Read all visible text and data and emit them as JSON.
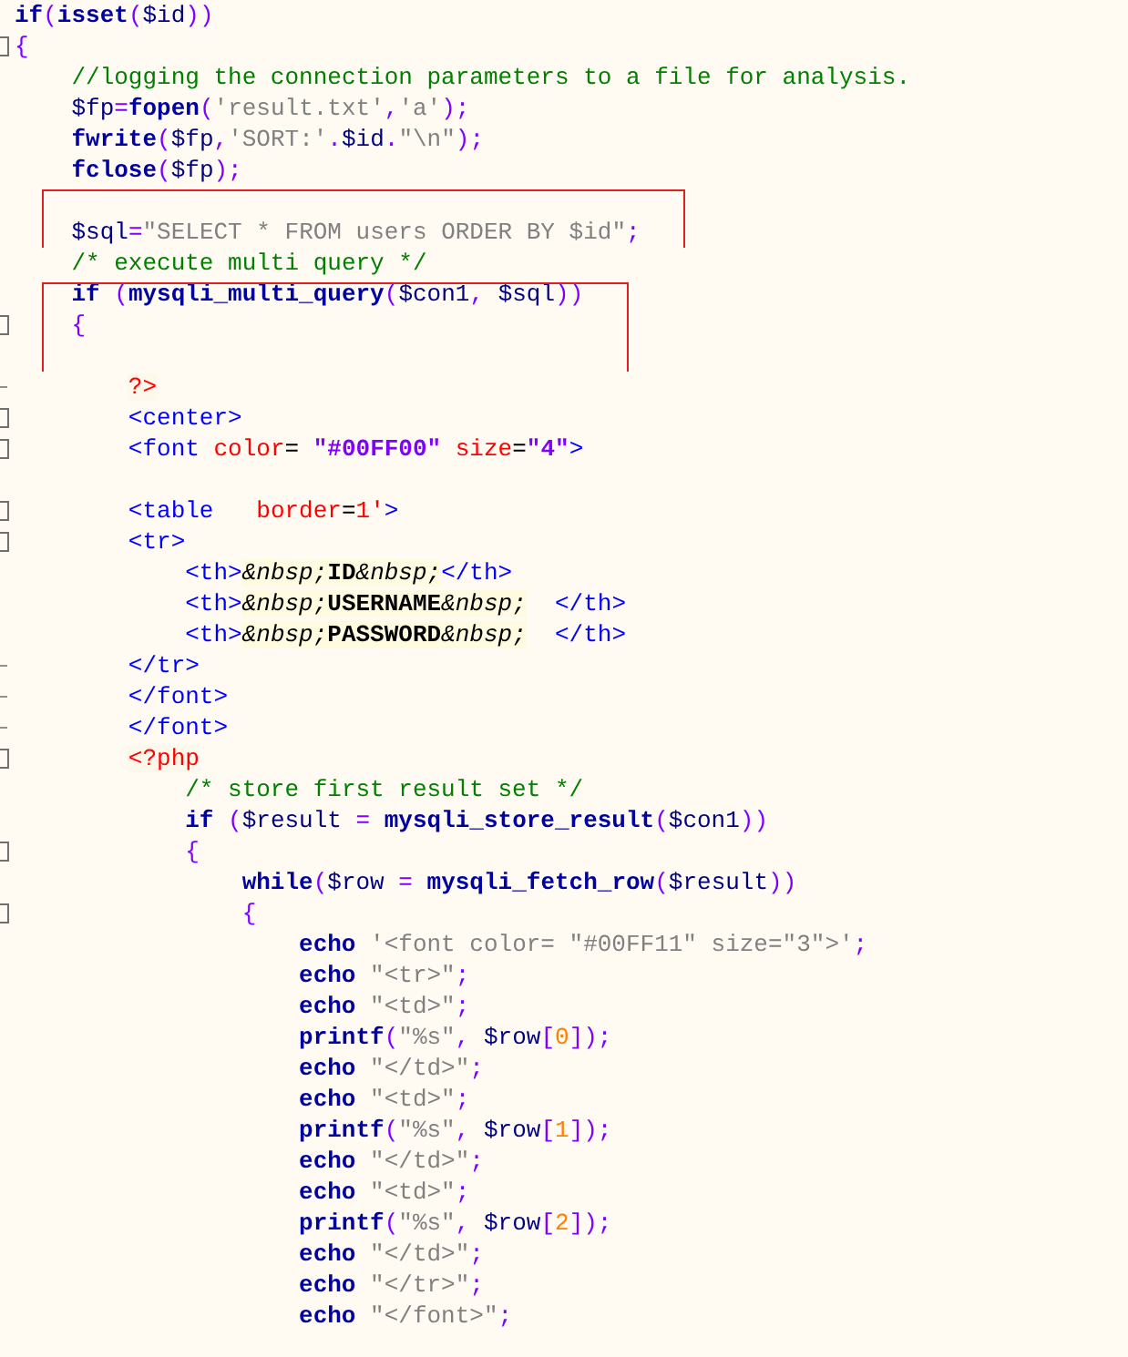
{
  "editor": {
    "blocks": [
      {
        "boxed": false,
        "lines": [
          {
            "kind": "code",
            "tokens": [
              {
                "kind": "kw",
                "text": "if"
              },
              {
                "kind": "punct",
                "text": "("
              },
              {
                "kind": "kw",
                "text": "isset"
              },
              {
                "kind": "punct",
                "text": "("
              },
              {
                "kind": "var",
                "text": "$id"
              },
              {
                "kind": "punct",
                "text": "))"
              }
            ]
          },
          {
            "kind": "fold",
            "tokens": [
              {
                "kind": "punct",
                "text": "{"
              }
            ]
          },
          {
            "kind": "code",
            "tokens": [
              {
                "kind": "comment",
                "text": "    //logging the connection parameters to a file for analysis."
              }
            ]
          },
          {
            "kind": "code",
            "tokens": [
              {
                "kind": "var",
                "text": "    $fp"
              },
              {
                "kind": "punct",
                "text": "="
              },
              {
                "kind": "kw",
                "text": "fopen"
              },
              {
                "kind": "punct",
                "text": "("
              },
              {
                "kind": "str",
                "text": "'result.txt'"
              },
              {
                "kind": "punct",
                "text": ","
              },
              {
                "kind": "str",
                "text": "'a'"
              },
              {
                "kind": "punct",
                "text": ");"
              }
            ]
          },
          {
            "kind": "code",
            "tokens": [
              {
                "kind": "kw",
                "text": "    fwrite"
              },
              {
                "kind": "punct",
                "text": "("
              },
              {
                "kind": "var",
                "text": "$fp"
              },
              {
                "kind": "punct",
                "text": ","
              },
              {
                "kind": "str",
                "text": "'SORT:'"
              },
              {
                "kind": "punct",
                "text": "."
              },
              {
                "kind": "var",
                "text": "$id"
              },
              {
                "kind": "punct",
                "text": "."
              },
              {
                "kind": "str",
                "text": "\"\\n\""
              },
              {
                "kind": "punct",
                "text": ");"
              }
            ]
          },
          {
            "kind": "code",
            "tokens": [
              {
                "kind": "kw",
                "text": "    fclose"
              },
              {
                "kind": "punct",
                "text": "("
              },
              {
                "kind": "var",
                "text": "$fp"
              },
              {
                "kind": "punct",
                "text": ");"
              }
            ]
          }
        ]
      },
      {
        "boxed": true,
        "lines": [
          {
            "kind": "code"
          },
          {
            "kind": "code",
            "tokens": [
              {
                "kind": "var",
                "text": "    $sql"
              },
              {
                "kind": "punct",
                "text": "="
              },
              {
                "kind": "str",
                "text": "\"SELECT * FROM users ORDER BY $id\""
              },
              {
                "kind": "punct",
                "text": ";"
              }
            ]
          }
        ]
      },
      {
        "boxed": false,
        "lines": [
          {
            "kind": "code",
            "tokens": [
              {
                "kind": "comment",
                "text": "    /* execute multi query */"
              }
            ]
          }
        ]
      },
      {
        "boxed": true,
        "lines": [
          {
            "kind": "code",
            "tokens": [
              {
                "kind": "kw",
                "text": "    if"
              },
              {
                "kind": "punct",
                "text": " ("
              },
              {
                "kind": "kw",
                "text": "mysqli_multi_query"
              },
              {
                "kind": "punct",
                "text": "("
              },
              {
                "kind": "var",
                "text": "$con1"
              },
              {
                "kind": "punct",
                "text": ", "
              },
              {
                "kind": "var",
                "text": "$sql"
              },
              {
                "kind": "punct",
                "text": "))"
              }
            ]
          },
          {
            "kind": "fold",
            "tokens": [
              {
                "kind": "punct",
                "text": "    {"
              }
            ]
          },
          {
            "kind": "code"
          }
        ]
      },
      {
        "boxed": false,
        "lines": [
          {
            "kind": "fold-end",
            "tokens": [
              {
                "kind": "phptag",
                "text": "        ?>"
              }
            ]
          },
          {
            "kind": "fold",
            "tokens": [
              {
                "kind": "tag",
                "text": "        <center>"
              }
            ]
          },
          {
            "kind": "fold",
            "tokens": [
              {
                "kind": "tag",
                "text": "        <font "
              },
              {
                "kind": "attr",
                "text": "color"
              },
              {
                "kind": "plain",
                "text": "= "
              },
              {
                "kind": "val",
                "text": "\"#00FF00\""
              },
              {
                "kind": "attr",
                "text": " size"
              },
              {
                "kind": "plain",
                "text": "="
              },
              {
                "kind": "val",
                "text": "\"4\""
              },
              {
                "kind": "tag",
                "text": ">"
              }
            ]
          },
          {
            "kind": "code"
          },
          {
            "kind": "fold",
            "tokens": [
              {
                "kind": "tag",
                "text": "        <table   "
              },
              {
                "kind": "attr",
                "text": "border"
              },
              {
                "kind": "plain",
                "text": "="
              },
              {
                "kind": "attr",
                "text": "1'"
              },
              {
                "kind": "tag",
                "text": ">"
              }
            ]
          },
          {
            "kind": "fold",
            "tokens": [
              {
                "kind": "tag",
                "text": "        <tr>"
              }
            ]
          },
          {
            "kind": "code",
            "tokens": [
              {
                "kind": "tag",
                "text": "            <th>"
              },
              {
                "kind": "entity",
                "text": "&nbsp;"
              },
              {
                "kind": "bold",
                "text": "ID"
              },
              {
                "kind": "entity",
                "text": "&nbsp;"
              },
              {
                "kind": "tag",
                "text": "</th>"
              }
            ]
          },
          {
            "kind": "code",
            "tokens": [
              {
                "kind": "tag",
                "text": "            <th>"
              },
              {
                "kind": "entity",
                "text": "&nbsp;"
              },
              {
                "kind": "bold",
                "text": "USERNAME"
              },
              {
                "kind": "entity",
                "text": "&nbsp;"
              },
              {
                "kind": "tag",
                "text": "  </th>"
              }
            ]
          },
          {
            "kind": "code",
            "tokens": [
              {
                "kind": "tag",
                "text": "            <th>"
              },
              {
                "kind": "entity",
                "text": "&nbsp;"
              },
              {
                "kind": "bold",
                "text": "PASSWORD"
              },
              {
                "kind": "entity",
                "text": "&nbsp;"
              },
              {
                "kind": "tag",
                "text": "  </th>"
              }
            ]
          },
          {
            "kind": "fold-end",
            "tokens": [
              {
                "kind": "tag",
                "text": "        </tr>"
              }
            ]
          },
          {
            "kind": "fold-end",
            "tokens": [
              {
                "kind": "tag",
                "text": "        </font>"
              }
            ]
          },
          {
            "kind": "fold-end",
            "tokens": [
              {
                "kind": "tag",
                "text": "        </font>"
              }
            ]
          },
          {
            "kind": "fold",
            "tokens": [
              {
                "kind": "phptag",
                "text": "        <?php"
              }
            ]
          },
          {
            "kind": "code",
            "tokens": [
              {
                "kind": "comment",
                "text": "            /* store first result set */"
              }
            ]
          },
          {
            "kind": "code",
            "tokens": [
              {
                "kind": "kw",
                "text": "            if"
              },
              {
                "kind": "punct",
                "text": " ("
              },
              {
                "kind": "var",
                "text": "$result"
              },
              {
                "kind": "punct",
                "text": " = "
              },
              {
                "kind": "kw",
                "text": "mysqli_store_result"
              },
              {
                "kind": "punct",
                "text": "("
              },
              {
                "kind": "var",
                "text": "$con1"
              },
              {
                "kind": "punct",
                "text": "))"
              }
            ]
          },
          {
            "kind": "fold",
            "tokens": [
              {
                "kind": "punct",
                "text": "            {"
              }
            ]
          },
          {
            "kind": "code",
            "tokens": [
              {
                "kind": "kw",
                "text": "                while"
              },
              {
                "kind": "punct",
                "text": "("
              },
              {
                "kind": "var",
                "text": "$row"
              },
              {
                "kind": "punct",
                "text": " = "
              },
              {
                "kind": "kw",
                "text": "mysqli_fetch_row"
              },
              {
                "kind": "punct",
                "text": "("
              },
              {
                "kind": "var",
                "text": "$result"
              },
              {
                "kind": "punct",
                "text": "))"
              }
            ]
          },
          {
            "kind": "fold",
            "tokens": [
              {
                "kind": "punct",
                "text": "                {"
              }
            ]
          },
          {
            "kind": "code",
            "tokens": [
              {
                "kind": "kw",
                "text": "                    echo"
              },
              {
                "kind": "str",
                "text": " '<font color= \"#00FF11\" size=\"3\">'"
              },
              {
                "kind": "punct",
                "text": ";"
              }
            ]
          },
          {
            "kind": "code",
            "tokens": [
              {
                "kind": "kw",
                "text": "                    echo"
              },
              {
                "kind": "str",
                "text": " \"<tr>\""
              },
              {
                "kind": "punct",
                "text": ";"
              }
            ]
          },
          {
            "kind": "code",
            "tokens": [
              {
                "kind": "kw",
                "text": "                    echo"
              },
              {
                "kind": "str",
                "text": " \"<td>\""
              },
              {
                "kind": "punct",
                "text": ";"
              }
            ]
          },
          {
            "kind": "code",
            "tokens": [
              {
                "kind": "kw",
                "text": "                    printf"
              },
              {
                "kind": "punct",
                "text": "("
              },
              {
                "kind": "str",
                "text": "\"%s\""
              },
              {
                "kind": "punct",
                "text": ", "
              },
              {
                "kind": "var",
                "text": "$row"
              },
              {
                "kind": "punct",
                "text": "["
              },
              {
                "kind": "num",
                "text": "0"
              },
              {
                "kind": "punct",
                "text": "]);"
              }
            ]
          },
          {
            "kind": "code",
            "tokens": [
              {
                "kind": "kw",
                "text": "                    echo"
              },
              {
                "kind": "str",
                "text": " \"</td>\""
              },
              {
                "kind": "punct",
                "text": ";"
              }
            ]
          },
          {
            "kind": "code",
            "tokens": [
              {
                "kind": "kw",
                "text": "                    echo"
              },
              {
                "kind": "str",
                "text": " \"<td>\""
              },
              {
                "kind": "punct",
                "text": ";"
              }
            ]
          },
          {
            "kind": "code",
            "tokens": [
              {
                "kind": "kw",
                "text": "                    printf"
              },
              {
                "kind": "punct",
                "text": "("
              },
              {
                "kind": "str",
                "text": "\"%s\""
              },
              {
                "kind": "punct",
                "text": ", "
              },
              {
                "kind": "var",
                "text": "$row"
              },
              {
                "kind": "punct",
                "text": "["
              },
              {
                "kind": "num",
                "text": "1"
              },
              {
                "kind": "punct",
                "text": "]);"
              }
            ]
          },
          {
            "kind": "code",
            "tokens": [
              {
                "kind": "kw",
                "text": "                    echo"
              },
              {
                "kind": "str",
                "text": " \"</td>\""
              },
              {
                "kind": "punct",
                "text": ";"
              }
            ]
          },
          {
            "kind": "code",
            "tokens": [
              {
                "kind": "kw",
                "text": "                    echo"
              },
              {
                "kind": "str",
                "text": " \"<td>\""
              },
              {
                "kind": "punct",
                "text": ";"
              }
            ]
          },
          {
            "kind": "code",
            "tokens": [
              {
                "kind": "kw",
                "text": "                    printf"
              },
              {
                "kind": "punct",
                "text": "("
              },
              {
                "kind": "str",
                "text": "\"%s\""
              },
              {
                "kind": "punct",
                "text": ", "
              },
              {
                "kind": "var",
                "text": "$row"
              },
              {
                "kind": "punct",
                "text": "["
              },
              {
                "kind": "num",
                "text": "2"
              },
              {
                "kind": "punct",
                "text": "]);"
              }
            ]
          },
          {
            "kind": "code",
            "tokens": [
              {
                "kind": "kw",
                "text": "                    echo"
              },
              {
                "kind": "str",
                "text": " \"</td>\""
              },
              {
                "kind": "punct",
                "text": ";"
              }
            ]
          },
          {
            "kind": "code",
            "tokens": [
              {
                "kind": "kw",
                "text": "                    echo"
              },
              {
                "kind": "str",
                "text": " \"</tr>\""
              },
              {
                "kind": "punct",
                "text": ";"
              }
            ]
          },
          {
            "kind": "code",
            "tokens": [
              {
                "kind": "kw",
                "text": "                    echo"
              },
              {
                "kind": "str",
                "text": " \"</font>\""
              },
              {
                "kind": "punct",
                "text": ";"
              }
            ]
          }
        ]
      }
    ]
  }
}
